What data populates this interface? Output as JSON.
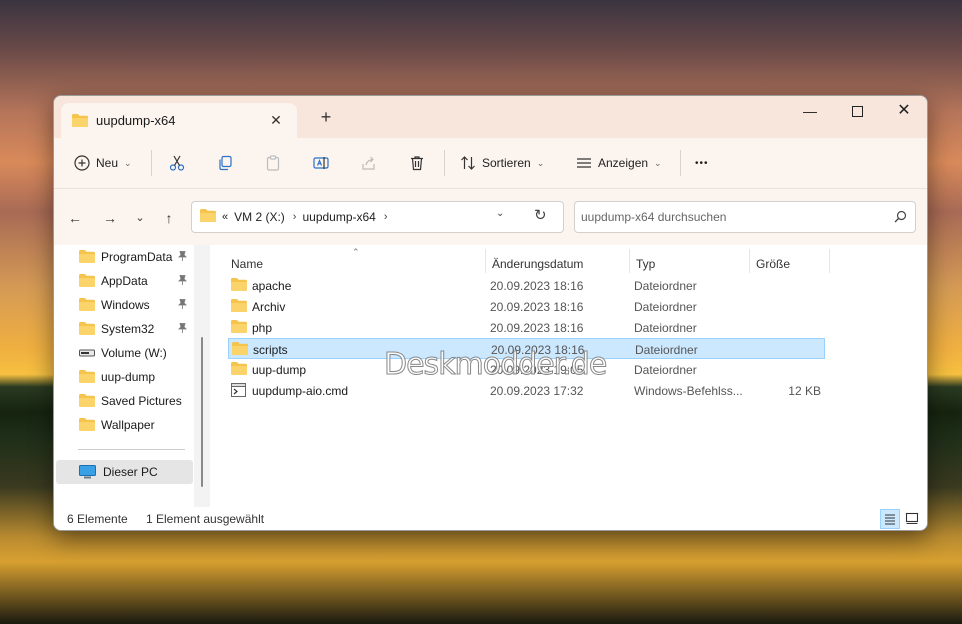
{
  "tab": {
    "title": "uupdump-x64",
    "close": "✕",
    "new": "+"
  },
  "window_controls": {
    "minimize": "—",
    "close": "✕"
  },
  "toolbar": {
    "new_label": "Neu",
    "sort_label": "Sortieren",
    "view_label": "Anzeigen",
    "more_label": "•••"
  },
  "address": {
    "overflow": "«",
    "crumbs": [
      "VM 2 (X:)",
      "uupdump-x64"
    ],
    "search_placeholder": "uupdump-x64 durchsuchen"
  },
  "sidebar": {
    "items": [
      {
        "label": "ProgramData",
        "icon": "folder-icon",
        "pinned": true
      },
      {
        "label": "AppData",
        "icon": "folder-icon",
        "pinned": true
      },
      {
        "label": "Windows",
        "icon": "folder-icon",
        "pinned": true
      },
      {
        "label": "System32",
        "icon": "folder-icon",
        "pinned": true
      },
      {
        "label": "Volume (W:)",
        "icon": "drive-icon",
        "pinned": false
      },
      {
        "label": "uup-dump",
        "icon": "folder-icon",
        "pinned": false
      },
      {
        "label": "Saved Pictures",
        "icon": "folder-icon",
        "pinned": false
      },
      {
        "label": "Wallpaper",
        "icon": "folder-icon",
        "pinned": false
      }
    ],
    "this_pc": "Dieser PC"
  },
  "columns": {
    "name": "Name",
    "date": "Änderungsdatum",
    "type": "Typ",
    "size": "Größe"
  },
  "files": [
    {
      "name": "apache",
      "date": "20.09.2023 18:16",
      "type": "Dateiordner",
      "size": "",
      "icon": "folder-icon",
      "selected": false
    },
    {
      "name": "Archiv",
      "date": "20.09.2023 18:16",
      "type": "Dateiordner",
      "size": "",
      "icon": "folder-icon",
      "selected": false
    },
    {
      "name": "php",
      "date": "20.09.2023 18:16",
      "type": "Dateiordner",
      "size": "",
      "icon": "folder-icon",
      "selected": false
    },
    {
      "name": "scripts",
      "date": "20.09.2023 18:16",
      "type": "Dateiordner",
      "size": "",
      "icon": "folder-icon",
      "selected": true
    },
    {
      "name": "uup-dump",
      "date": "20.09.2023 19:05",
      "type": "Dateiordner",
      "size": "",
      "icon": "folder-icon",
      "selected": false
    },
    {
      "name": "uupdump-aio.cmd",
      "date": "20.09.2023 17:32",
      "type": "Windows-Befehlss...",
      "size": "12 KB",
      "icon": "cmd-file-icon",
      "selected": false
    }
  ],
  "status": {
    "count": "6 Elemente",
    "selection": "1 Element ausgewählt"
  },
  "watermark": "Deskmodder.de",
  "colors": {
    "selection": "#cce8ff",
    "selection_border": "#99d1ff",
    "folder": "#f4c44c",
    "titlebar": "#f8e6dc"
  }
}
